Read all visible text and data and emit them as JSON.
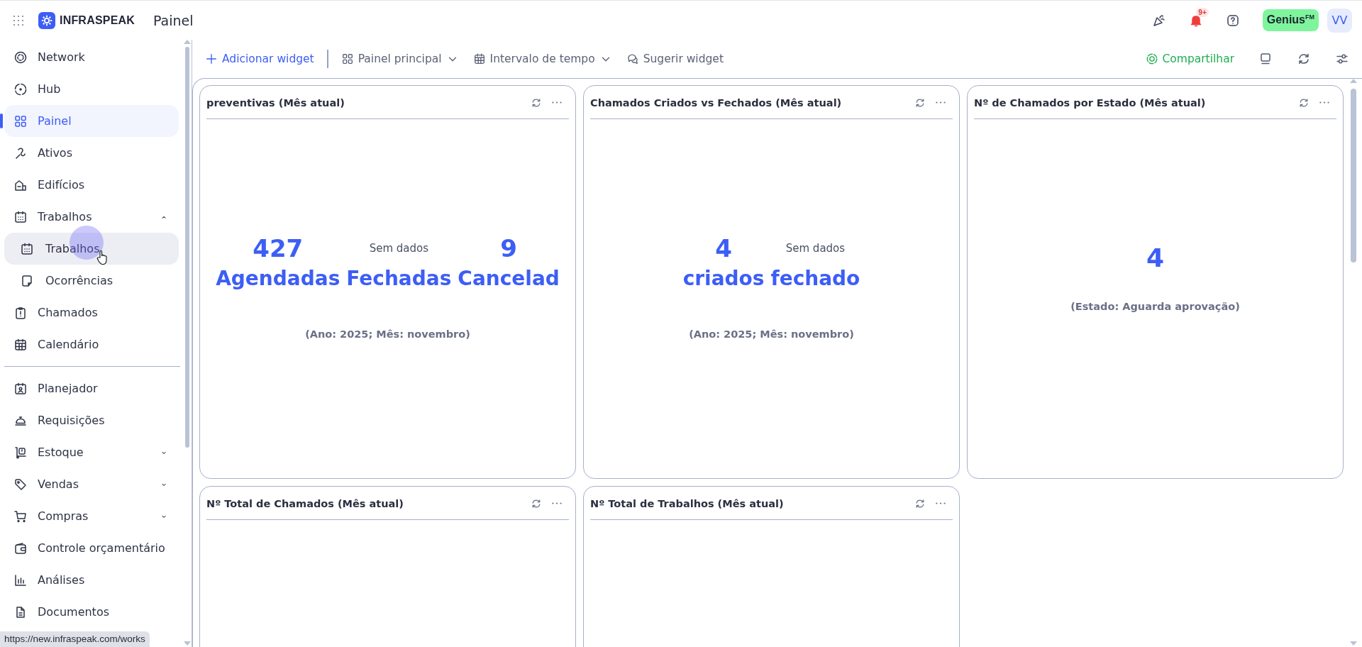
{
  "header": {
    "brand": "INFRASPEAK",
    "title": "Painel",
    "notifications_badge": "9+",
    "plan_button": "Genius$^{FM}$",
    "avatar": "VV"
  },
  "sidebar": {
    "sections": [
      {
        "items": [
          {
            "label": "Network",
            "kind": "item",
            "selected": false,
            "hovered": false
          },
          {
            "label": "Hub",
            "kind": "item",
            "selected": false,
            "hovered": false
          },
          {
            "label": "Painel",
            "kind": "item",
            "selected": true,
            "hovered": false
          },
          {
            "label": "Ativos",
            "kind": "item",
            "selected": false,
            "hovered": false
          },
          {
            "label": "Edifícios",
            "kind": "item",
            "selected": false,
            "hovered": false
          },
          {
            "label": "Trabalhos",
            "kind": "group",
            "expanded": true,
            "selected": false,
            "hovered": false,
            "children": [
              {
                "label": "Trabalhos",
                "kind": "item",
                "selected": false,
                "hovered": true
              },
              {
                "label": "Ocorrências",
                "kind": "item",
                "selected": false,
                "hovered": false
              }
            ]
          },
          {
            "label": "Chamados",
            "kind": "item",
            "selected": false,
            "hovered": false
          },
          {
            "label": "Calendário",
            "kind": "item",
            "selected": false,
            "hovered": false
          }
        ]
      },
      {
        "items": [
          {
            "label": "Planejador",
            "kind": "item",
            "selected": false,
            "hovered": false
          },
          {
            "label": "Requisições",
            "kind": "item",
            "selected": false,
            "hovered": false
          },
          {
            "label": "Estoque",
            "kind": "group",
            "expanded": false,
            "selected": false,
            "hovered": false
          },
          {
            "label": "Vendas",
            "kind": "group",
            "expanded": false,
            "selected": false,
            "hovered": false
          },
          {
            "label": "Compras",
            "kind": "group",
            "expanded": false,
            "selected": false,
            "hovered": false
          },
          {
            "label": "Controle orçamentário",
            "kind": "item",
            "selected": false,
            "hovered": false
          },
          {
            "label": "Análises",
            "kind": "item",
            "selected": false,
            "hovered": false
          },
          {
            "label": "Documentos",
            "kind": "item",
            "selected": false,
            "hovered": false
          }
        ]
      }
    ]
  },
  "toolbar": {
    "left": [
      {
        "label": "Adicionar widget",
        "primary": true,
        "dropdown": false
      },
      {
        "label": "Painel principal",
        "primary": false,
        "dropdown": true
      },
      {
        "label": "Intervalo de tempo",
        "primary": false,
        "dropdown": true
      },
      {
        "label": "Sugerir widget",
        "primary": false,
        "dropdown": false
      }
    ],
    "share": "Compartilhar"
  },
  "widgets": [
    {
      "title": "preventivas (Mês atual)",
      "kind": "stats",
      "stats": [
        {
          "kind": "number",
          "value": "427",
          "label": "Agendadas"
        },
        {
          "kind": "empty",
          "value": "Sem dados",
          "label": "Fechadas"
        },
        {
          "kind": "number",
          "value": "9",
          "label": "Cancelad"
        }
      ],
      "footnote": "(Ano: 2025; Mês: novembro)"
    },
    {
      "title": "Chamados Criados vs Fechados (Mês atual)",
      "kind": "stats",
      "stats": [
        {
          "kind": "number",
          "value": "4",
          "label": "criados"
        },
        {
          "kind": "empty",
          "value": "Sem dados",
          "label": "fechado"
        }
      ],
      "footnote": "(Ano: 2025; Mês: novembro)"
    },
    {
      "title": "Nº de Chamados por Estado (Mês atual)",
      "kind": "single",
      "value": "4",
      "footnote": "(Estado: Aguarda aprovação)"
    },
    {
      "title": "Nº Total de Chamados (Mês atual)",
      "kind": "empty"
    },
    {
      "title": "Nº Total de Trabalhos (Mês atual)",
      "kind": "empty"
    }
  ],
  "status_bar": {
    "url": "https://new.infraspeak.com/works"
  }
}
